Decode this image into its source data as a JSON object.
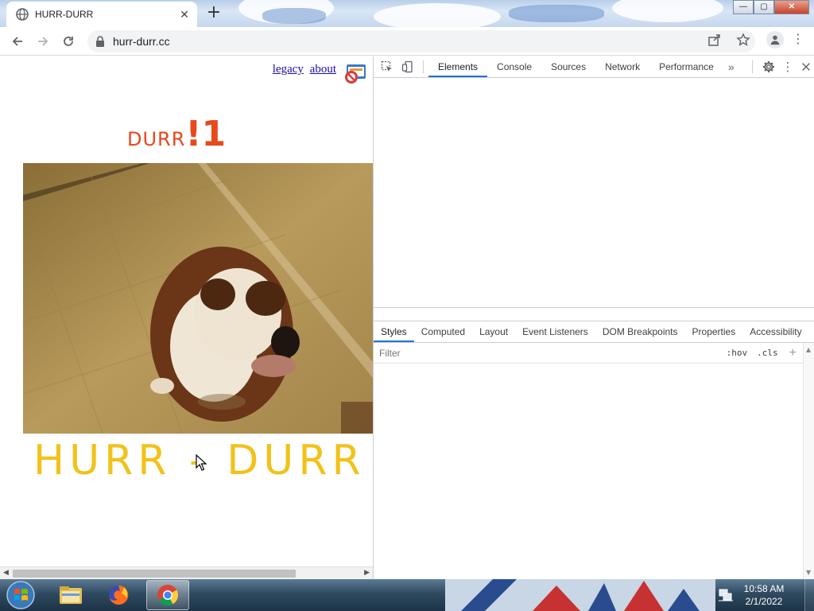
{
  "tab": {
    "title": "HURR-DURR",
    "close": "✕",
    "new_tab": "+"
  },
  "window": {
    "minimize": "—",
    "maximize": "▢",
    "close": "✕"
  },
  "toolbar": {
    "url": "hurr-durr.cc"
  },
  "page": {
    "links": {
      "legacy": "legacy",
      "about": "about"
    },
    "heading_small": "DURR",
    "heading_big": "!1",
    "banner": "HURR - DURR"
  },
  "devtools": {
    "tabs": [
      "Elements",
      "Console",
      "Sources",
      "Network",
      "Performance"
    ],
    "more": "»",
    "subtabs": [
      "Styles",
      "Computed",
      "Layout",
      "Event Listeners",
      "DOM Breakpoints",
      "Properties",
      "Accessibility"
    ],
    "filter_placeholder": "Filter",
    "hov": ":hov",
    "cls": ".cls",
    "plus": "+"
  },
  "taskbar": {
    "time": "10:58 AM",
    "date": "2/1/2022"
  },
  "colors": {
    "accent": "#1a73e8",
    "durr": "#e8481a",
    "banner": "#f2c21a",
    "link": "#1a0dab"
  }
}
